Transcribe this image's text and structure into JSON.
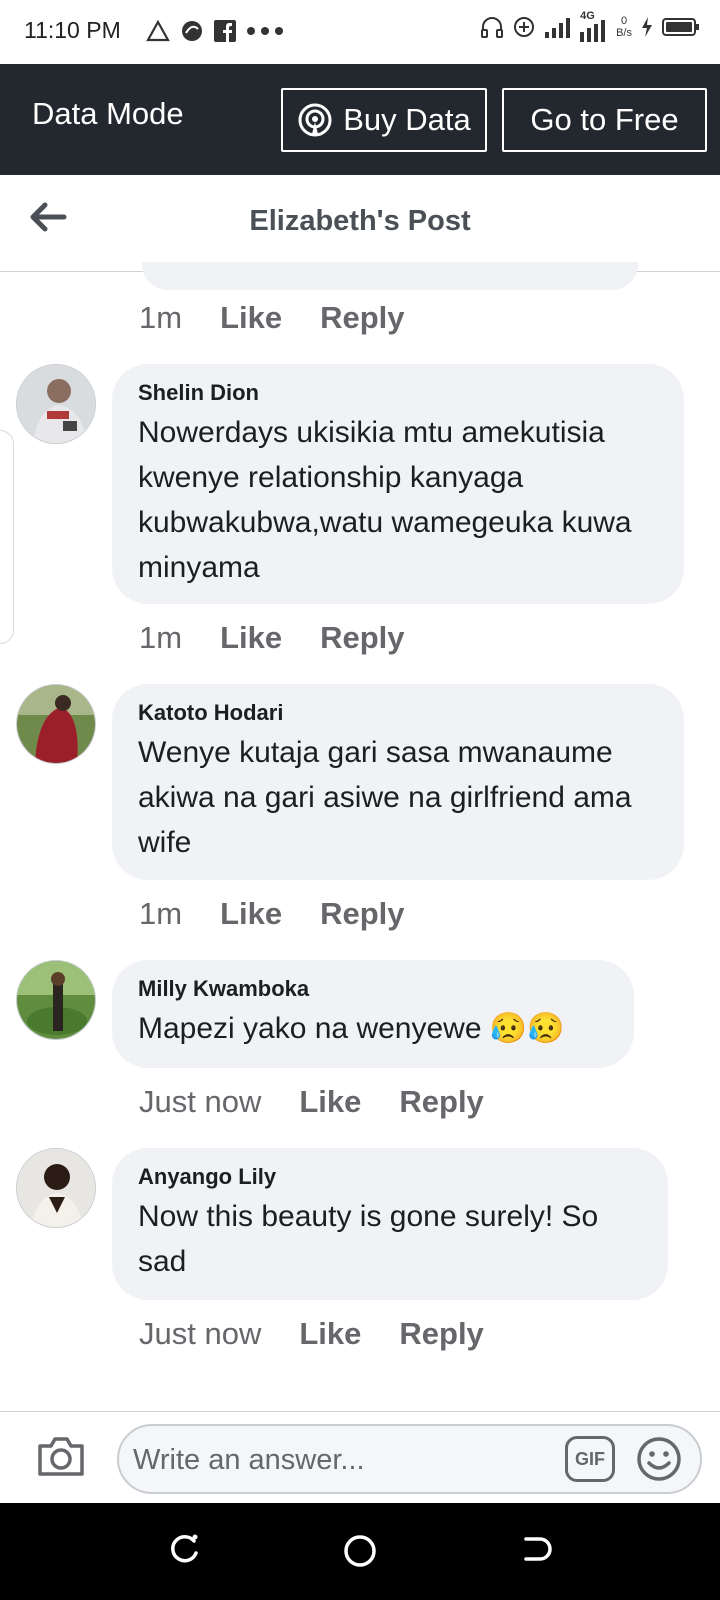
{
  "status_bar": {
    "time": "11:10 PM",
    "network_label": "4G",
    "speed_value": "0",
    "speed_unit": "B/s"
  },
  "data_bar": {
    "mode_label": "Data Mode",
    "buy_label": "Buy Data",
    "free_label": "Go to Free"
  },
  "header": {
    "title": "Elizabeth's Post"
  },
  "top_meta": {
    "time": "1m",
    "like": "Like",
    "reply": "Reply"
  },
  "comments": [
    {
      "author": "Shelin Dion",
      "text": "Nowerdays ukisikia mtu amekutisia kwenye relationship kanyaga kubwakubwa,watu wamegeuka kuwa minyama",
      "time": "1m",
      "like": "Like",
      "reply": "Reply"
    },
    {
      "author": "Katoto Hodari",
      "text": "Wenye kutaja gari sasa mwanaume akiwa na gari asiwe na girlfriend ama wife",
      "time": "1m",
      "like": "Like",
      "reply": "Reply"
    },
    {
      "author": "Milly Kwamboka",
      "text": "Mapezi yako na wenyewe 😥😥",
      "time": "Just now",
      "like": "Like",
      "reply": "Reply"
    },
    {
      "author": "Anyango Lily",
      "text": "Now this beauty is gone surely! So sad",
      "time": "Just now",
      "like": "Like",
      "reply": "Reply"
    }
  ],
  "composer": {
    "placeholder": "Write an answer...",
    "gif_label": "GIF"
  },
  "colors": {
    "header_bg": "#23272e",
    "bubble_bg": "#f0f2f5",
    "meta_text": "#65676b"
  }
}
